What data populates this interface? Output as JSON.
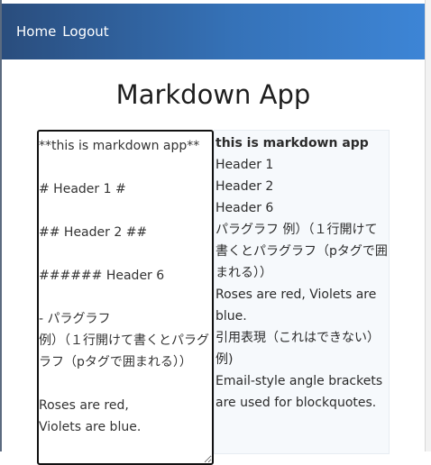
{
  "nav": {
    "home_label": "Home",
    "logout_label": "Logout"
  },
  "page_title": "Markdown App",
  "editor": {
    "value": "**this is markdown app**\n\n# Header 1 #\n\n## Header 2 ##\n\n###### Header 6\n\n- パラグラフ\n例）（１行開けて書くとパラグラフ（pタグで囲まれる））\n\nRoses are red,\nViolets are blue."
  },
  "preview": {
    "strong": "this is markdown app",
    "h1": "Header 1",
    "h2": "Header 2",
    "h6": "Header 6",
    "paragraph": "パラグラフ 例）（１行開けて書くとパラグラフ（pタグで囲まれる））",
    "roses": "Roses are red, Violets are blue.",
    "quote": "引用表現（これはできない）例)",
    "email": "Email-style angle brackets are used for blockquotes."
  },
  "colors": {
    "navbar_start": "#2a4d7d",
    "navbar_end": "#3d85d6",
    "preview_bg": "#f6f9fc"
  }
}
